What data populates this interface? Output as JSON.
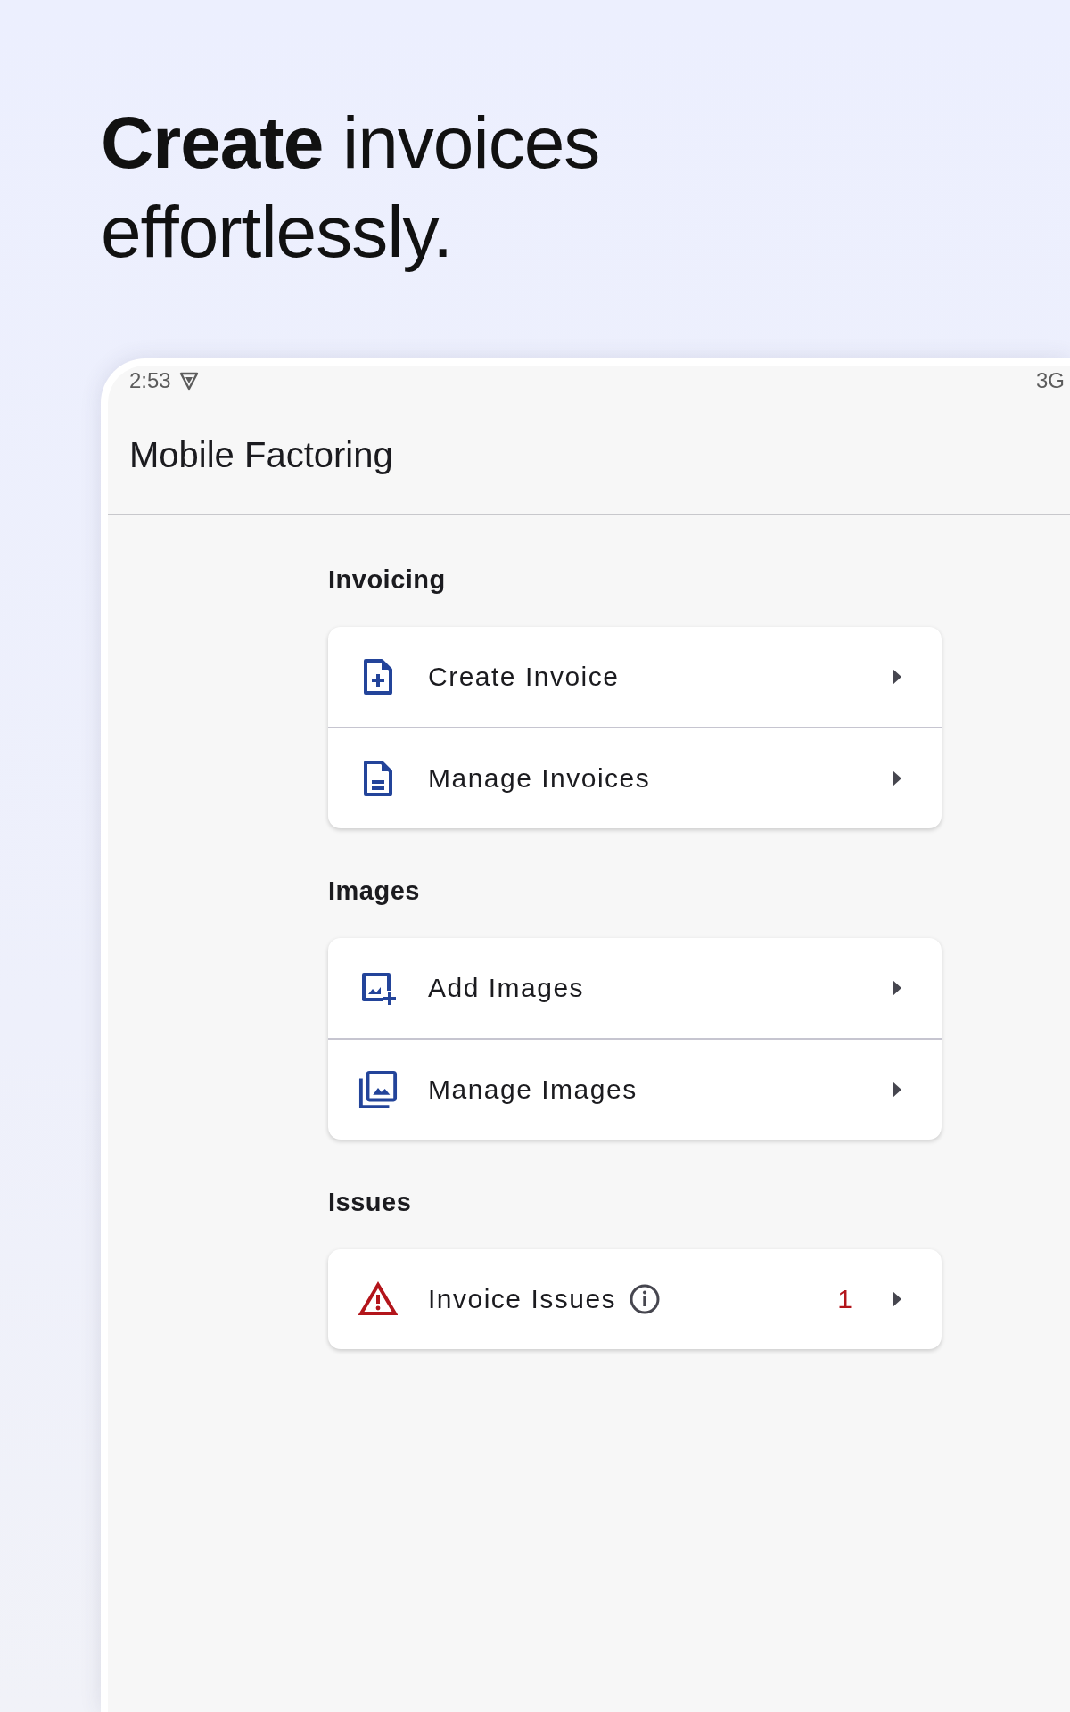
{
  "headline": "**Create** invoices effortlessly.",
  "status_bar": {
    "time": "2:53",
    "network": "3G"
  },
  "app_bar": {
    "title": "Mobile Factoring"
  },
  "sections": [
    {
      "title": "Invoicing",
      "items": [
        {
          "kind": "create",
          "label": "Create Invoice"
        },
        {
          "kind": "document",
          "label": "Manage Invoices"
        }
      ]
    },
    {
      "title": "Images",
      "items": [
        {
          "kind": "addimage",
          "label": "Add Images"
        },
        {
          "kind": "gallery",
          "label": "Manage Images"
        }
      ]
    },
    {
      "title": "Issues",
      "items": [
        {
          "kind": "warning",
          "label": "Invoice Issues",
          "info": true,
          "count": "1"
        }
      ]
    }
  ]
}
